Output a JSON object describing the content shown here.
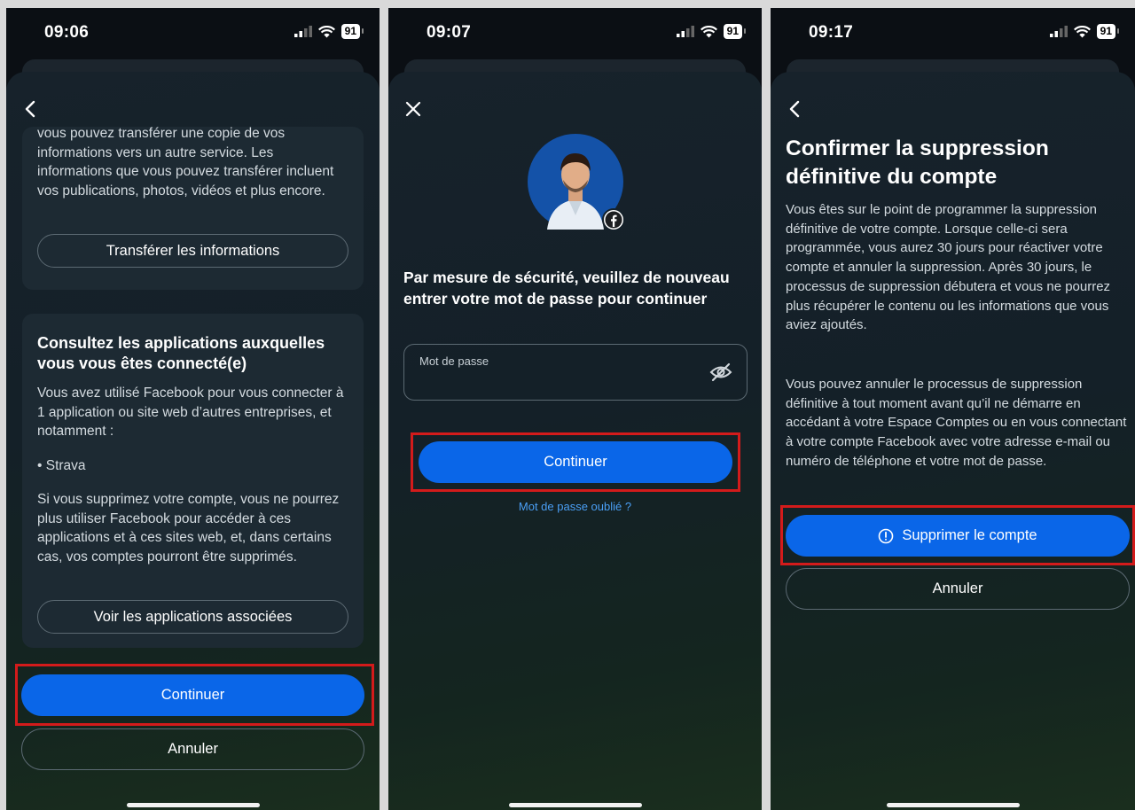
{
  "screen1": {
    "status": {
      "time": "09:06",
      "battery": "91"
    },
    "transfer_text": "vous pouvez transférer une copie de vos informations vers un autre service. Les informations que vous pouvez transférer incluent vos publications, photos, vidéos et plus encore.",
    "transfer_button": "Transférer les informations",
    "apps_title": "Consultez les applications auxquelles vous vous êtes connecté(e)",
    "apps_intro": "Vous avez utilisé Facebook pour vous connecter à 1 application ou site web d’autres entreprises, et notamment :",
    "apps_list": [
      "Strava"
    ],
    "apps_warning": "Si vous supprimez votre compte, vous ne pourrez plus utiliser Facebook pour accéder à ces applications et à ces sites web, et, dans certains cas, vos comptes pourront être supprimés.",
    "view_apps_button": "Voir les applications associées",
    "continue_button": "Continuer",
    "cancel_button": "Annuler"
  },
  "screen2": {
    "status": {
      "time": "09:07",
      "battery": "91"
    },
    "prompt": "Par mesure de sécurité, veuillez de nouveau entrer votre mot de passe pour continuer",
    "password_label": "Mot de passe",
    "password_value": "",
    "continue_button": "Continuer",
    "forgot_link": "Mot de passe oublié ?"
  },
  "screen3": {
    "status": {
      "time": "09:17",
      "battery": "91"
    },
    "title": "Confirmer la suppression définitive du compte",
    "paragraph1": "Vous êtes sur le point de programmer la suppression définitive de votre compte. Lorsque celle-ci sera programmée, vous aurez 30 jours pour réactiver votre compte et annuler la suppression. Après 30 jours, le processus de suppression débutera et vous ne pourrez plus récupérer le contenu ou les informations que vous aviez ajoutés.",
    "paragraph2": "Vous pouvez annuler le processus de suppression définitive à tout moment avant qu’il ne démarre en accédant à votre Espace Comptes ou en vous connectant à votre compte Facebook avec votre adresse e-mail ou numéro de téléphone et votre mot de passe.",
    "delete_button": "Supprimer le compte",
    "cancel_button": "Annuler"
  },
  "colors": {
    "primary_button": "#0a66e8",
    "highlight": "#d31b1b",
    "link": "#4a9ff5",
    "card": "#1d2a33"
  },
  "icons": {
    "back": "chevron-left-icon",
    "close": "close-icon",
    "signal": "signal-icon",
    "wifi": "wifi-icon",
    "eye_off": "eye-off-icon",
    "alert": "alert-circle-icon",
    "facebook_badge": "facebook-icon"
  }
}
